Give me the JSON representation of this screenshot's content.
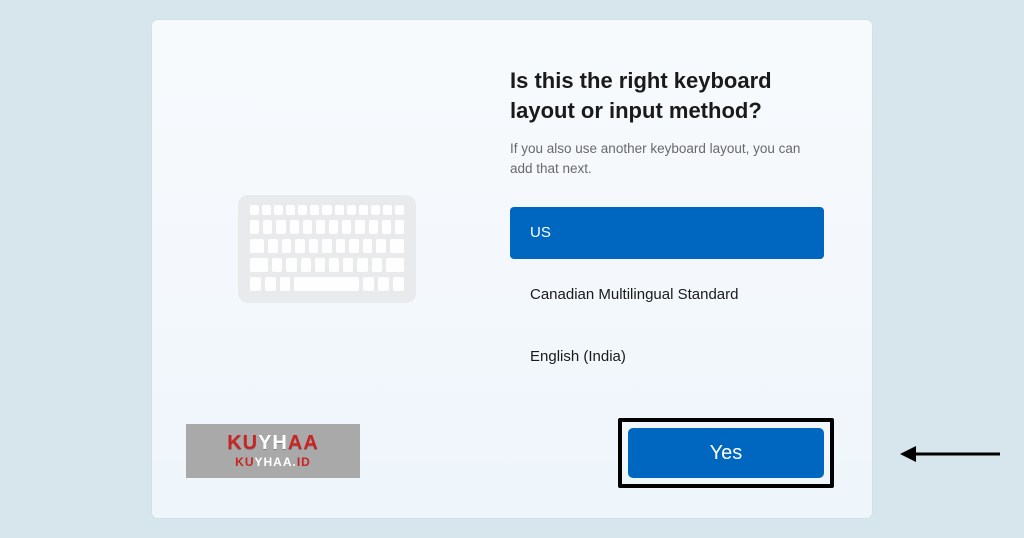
{
  "title": "Is this the right keyboard layout or input method?",
  "subtitle": "If you also use another keyboard layout, you can add that next.",
  "layouts": {
    "selected": "US",
    "option1": "Canadian Multilingual Standard",
    "option2": "English (India)"
  },
  "actions": {
    "yes_label": "Yes"
  },
  "watermark": {
    "top_red1": "KU",
    "top_white": "YH",
    "top_red2": "AA",
    "bottom_red1": "KU",
    "bottom_white": "YHAA.",
    "bottom_red2": "ID"
  },
  "colors": {
    "accent": "#0067c0",
    "page_bg": "#d7e5ec"
  }
}
